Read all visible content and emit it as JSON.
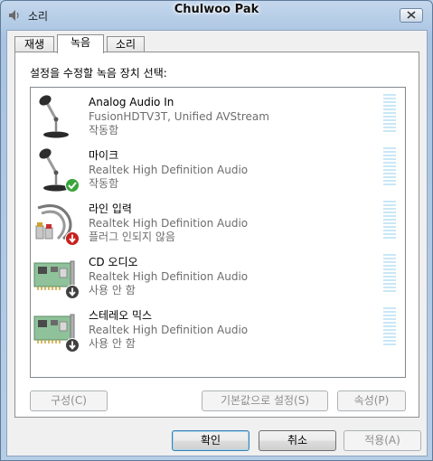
{
  "window": {
    "title_left": "소리",
    "title_center": "Chulwoo Pak"
  },
  "tabs": [
    {
      "label": "재생"
    },
    {
      "label": "녹음"
    },
    {
      "label": "소리"
    }
  ],
  "instruction": "설정을 수정할 녹음 장치 선택:",
  "devices": [
    {
      "name": "Analog Audio In",
      "description": "FusionHDTV3T, Unified AVStream",
      "status": "작동함",
      "icon": "microphone-icon",
      "overlay": "none"
    },
    {
      "name": "마이크",
      "description": "Realtek High Definition Audio",
      "status": "작동함",
      "icon": "microphone-icon",
      "overlay": "default-check-icon"
    },
    {
      "name": "라인 입력",
      "description": "Realtek High Definition Audio",
      "status": "플러그 인되지 않음",
      "icon": "rca-cable-icon",
      "overlay": "unplugged-icon"
    },
    {
      "name": "CD 오디오",
      "description": "Realtek High Definition Audio",
      "status": "사용 안 함",
      "icon": "sound-card-icon",
      "overlay": "disabled-icon"
    },
    {
      "name": "스테레오 믹스",
      "description": "Realtek High Definition Audio",
      "status": "사용 안 함",
      "icon": "sound-card-icon",
      "overlay": "disabled-icon"
    }
  ],
  "buttons": {
    "configure": "구성(C)",
    "set_default": "기본값으로 설정(S)",
    "properties": "속성(P)",
    "ok": "확인",
    "cancel": "취소",
    "apply": "적용(A)"
  },
  "colors": {
    "meter": "#c9e7f5",
    "check_badge": "#3aa53a",
    "unplugged_badge": "#c8201e",
    "disabled_badge": "#404040"
  }
}
